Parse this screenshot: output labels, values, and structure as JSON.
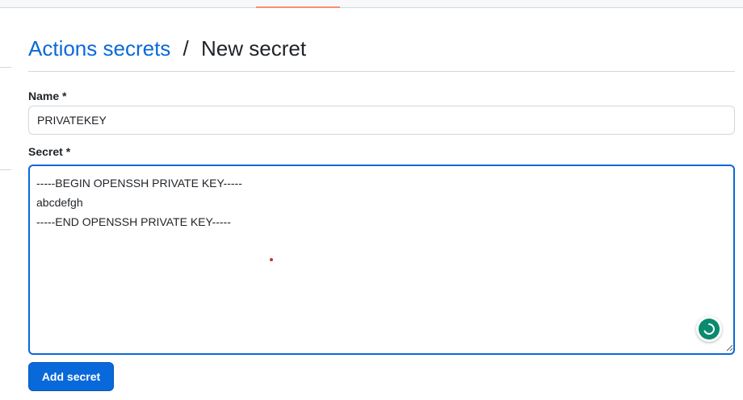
{
  "breadcrumb": {
    "parent_link": "Actions secrets",
    "separator": "/",
    "current": "New secret"
  },
  "form": {
    "name_label": "Name *",
    "name_value": "PRIVATEKEY",
    "secret_label": "Secret *",
    "secret_value": "-----BEGIN OPENSSH PRIVATE KEY-----\nabcdefgh\n-----END OPENSSH PRIVATE KEY-----",
    "submit_label": "Add secret"
  },
  "icons": {
    "assistant": "grammarly-assistant-icon",
    "resize": "resize-grip-icon"
  },
  "colors": {
    "link": "#0969da",
    "primary_button": "#0969da",
    "focus_border": "#0969da",
    "tab_underline": "#fd8c73",
    "assistant": "#0a8a6e"
  }
}
